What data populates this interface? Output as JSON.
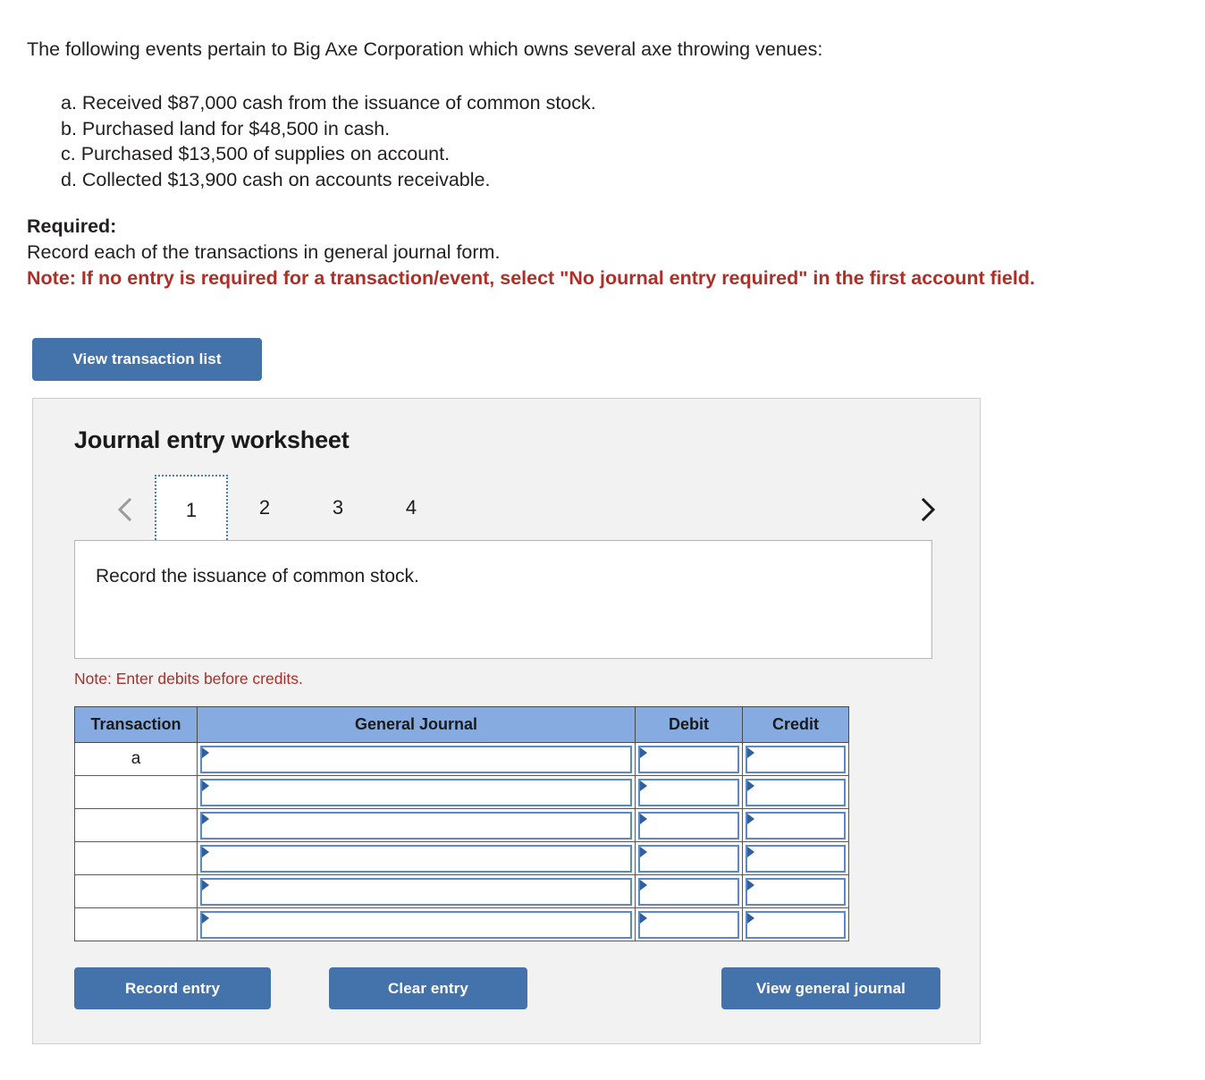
{
  "problem": {
    "intro": "The following events pertain to Big Axe Corporation which owns several axe throwing venues:",
    "events": [
      "a. Received $87,000 cash from the issuance of common stock.",
      "b. Purchased land for $48,500 in cash.",
      "c. Purchased $13,500 of supplies on account.",
      "d. Collected $13,900 cash on accounts receivable."
    ],
    "required_label": "Required:",
    "required_text": "Record each of the transactions in general journal form.",
    "required_note": "Note: If no entry is required for a transaction/event, select \"No journal entry required\" in the first account field."
  },
  "toolbar": {
    "view_transaction_list_label": "View transaction list"
  },
  "worksheet": {
    "title": "Journal entry worksheet",
    "pager": {
      "prev_icon": "chevron-left-icon",
      "next_icon": "chevron-right-icon",
      "tabs": [
        "1",
        "2",
        "3",
        "4"
      ],
      "active_tab": "1"
    },
    "description": "Record the issuance of common stock.",
    "note": "Note: Enter debits before credits.",
    "table": {
      "headers": [
        "Transaction",
        "General Journal",
        "Debit",
        "Credit"
      ],
      "rows": [
        {
          "transaction": "a",
          "general_journal": "",
          "debit": "",
          "credit": ""
        },
        {
          "transaction": "",
          "general_journal": "",
          "debit": "",
          "credit": ""
        },
        {
          "transaction": "",
          "general_journal": "",
          "debit": "",
          "credit": ""
        },
        {
          "transaction": "",
          "general_journal": "",
          "debit": "",
          "credit": ""
        },
        {
          "transaction": "",
          "general_journal": "",
          "debit": "",
          "credit": ""
        },
        {
          "transaction": "",
          "general_journal": "",
          "debit": "",
          "credit": ""
        }
      ]
    },
    "buttons": {
      "record_entry": "Record entry",
      "clear_entry": "Clear entry",
      "view_general_journal": "View general journal"
    }
  },
  "colors": {
    "button_blue": "#4473ac",
    "table_header_blue": "#86abe0",
    "note_red": "#a8302a",
    "panel_gray": "#f2f2f2",
    "field_border_blue": "#5b89c3"
  }
}
